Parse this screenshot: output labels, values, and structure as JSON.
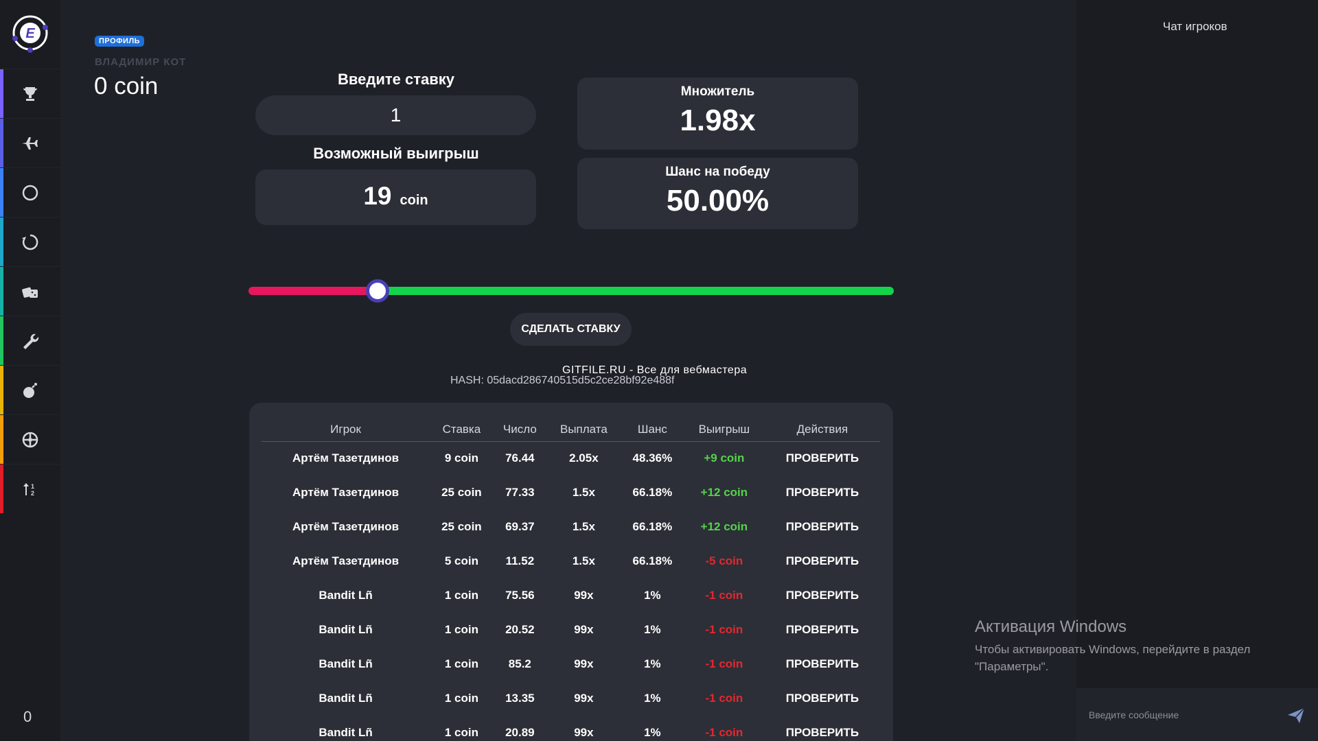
{
  "sidebar": {
    "logo_letter": "E",
    "nav_items": [
      {
        "icon": "trophy-icon",
        "accent": "#7b61ff"
      },
      {
        "icon": "airplane-icon",
        "accent": "#5b5fe6"
      },
      {
        "icon": "circle-icon",
        "accent": "#3b82f6"
      },
      {
        "icon": "refresh-icon",
        "accent": "#1ea7c9"
      },
      {
        "icon": "dice-icon",
        "accent": "#15b3a7"
      },
      {
        "icon": "wrench-icon",
        "accent": "#22c55e"
      },
      {
        "icon": "bomb-icon",
        "accent": "#eab308"
      },
      {
        "icon": "wheel-icon",
        "accent": "#f59e0b"
      },
      {
        "icon": "sort-icon",
        "accent": "#e11d2a"
      }
    ],
    "bottom_count": "0"
  },
  "profile": {
    "badge": "ПРОФИЛЬ",
    "name": "ВЛАДИМИР КОТ",
    "balance": "0 coin"
  },
  "bet": {
    "stake_label": "Введите ставку",
    "stake_value": "1",
    "win_label": "Возможный выигрыш",
    "win_value": "19",
    "win_unit": "coin",
    "multiplier_label": "Множитель",
    "multiplier_value": "1.98x",
    "chance_label": "Шанс на победу",
    "chance_value": "50.00%",
    "slider_fraction": 0.2,
    "button_label": "СДЕЛАТЬ СТАВКУ",
    "hash": "HASH: 05dacd286740515d5c2ce28bf92e488f"
  },
  "watermark": "GITFILE.RU - Все для вебмастера",
  "history": {
    "columns": [
      "Игрок",
      "Ставка",
      "Число",
      "Выплата",
      "Шанс",
      "Выигрыш",
      "Действия"
    ],
    "rows": [
      {
        "player": "Артём Тазетдинов",
        "stake": "9 coin",
        "number": "76.44",
        "payout": "2.05x",
        "chance": "48.36%",
        "win": "+9 coin",
        "win_type": "pos",
        "action": "ПРОВЕРИТЬ"
      },
      {
        "player": "Артём Тазетдинов",
        "stake": "25 coin",
        "number": "77.33",
        "payout": "1.5x",
        "chance": "66.18%",
        "win": "+12 coin",
        "win_type": "pos",
        "action": "ПРОВЕРИТЬ"
      },
      {
        "player": "Артём Тазетдинов",
        "stake": "25 coin",
        "number": "69.37",
        "payout": "1.5x",
        "chance": "66.18%",
        "win": "+12 coin",
        "win_type": "pos",
        "action": "ПРОВЕРИТЬ"
      },
      {
        "player": "Артём Тазетдинов",
        "stake": "5 coin",
        "number": "11.52",
        "payout": "1.5x",
        "chance": "66.18%",
        "win": "-5 coin",
        "win_type": "neg",
        "action": "ПРОВЕРИТЬ"
      },
      {
        "player": "Bandit Lñ",
        "stake": "1 coin",
        "number": "75.56",
        "payout": "99x",
        "chance": "1%",
        "win": "-1 coin",
        "win_type": "neg",
        "action": "ПРОВЕРИТЬ"
      },
      {
        "player": "Bandit Lñ",
        "stake": "1 coin",
        "number": "20.52",
        "payout": "99x",
        "chance": "1%",
        "win": "-1 coin",
        "win_type": "neg",
        "action": "ПРОВЕРИТЬ"
      },
      {
        "player": "Bandit Lñ",
        "stake": "1 coin",
        "number": "85.2",
        "payout": "99x",
        "chance": "1%",
        "win": "-1 coin",
        "win_type": "neg",
        "action": "ПРОВЕРИТЬ"
      },
      {
        "player": "Bandit Lñ",
        "stake": "1 coin",
        "number": "13.35",
        "payout": "99x",
        "chance": "1%",
        "win": "-1 coin",
        "win_type": "neg",
        "action": "ПРОВЕРИТЬ"
      },
      {
        "player": "Bandit Lñ",
        "stake": "1 coin",
        "number": "20.89",
        "payout": "99x",
        "chance": "1%",
        "win": "-1 coin",
        "win_type": "neg",
        "action": "ПРОВЕРИТЬ"
      }
    ]
  },
  "chat": {
    "title": "Чат игроков",
    "placeholder": "Введите сообщение",
    "send_icon": "send-icon"
  },
  "windows_activation": {
    "title": "Активация Windows",
    "text": "Чтобы активировать Windows, перейдите в раздел \"Параметры\"."
  },
  "colors": {
    "slider_lose": "#e8175d",
    "slider_win": "#14d44c",
    "win_positive": "#55d34c",
    "win_negative": "#e6262f",
    "badge": "#1e6fd9"
  }
}
